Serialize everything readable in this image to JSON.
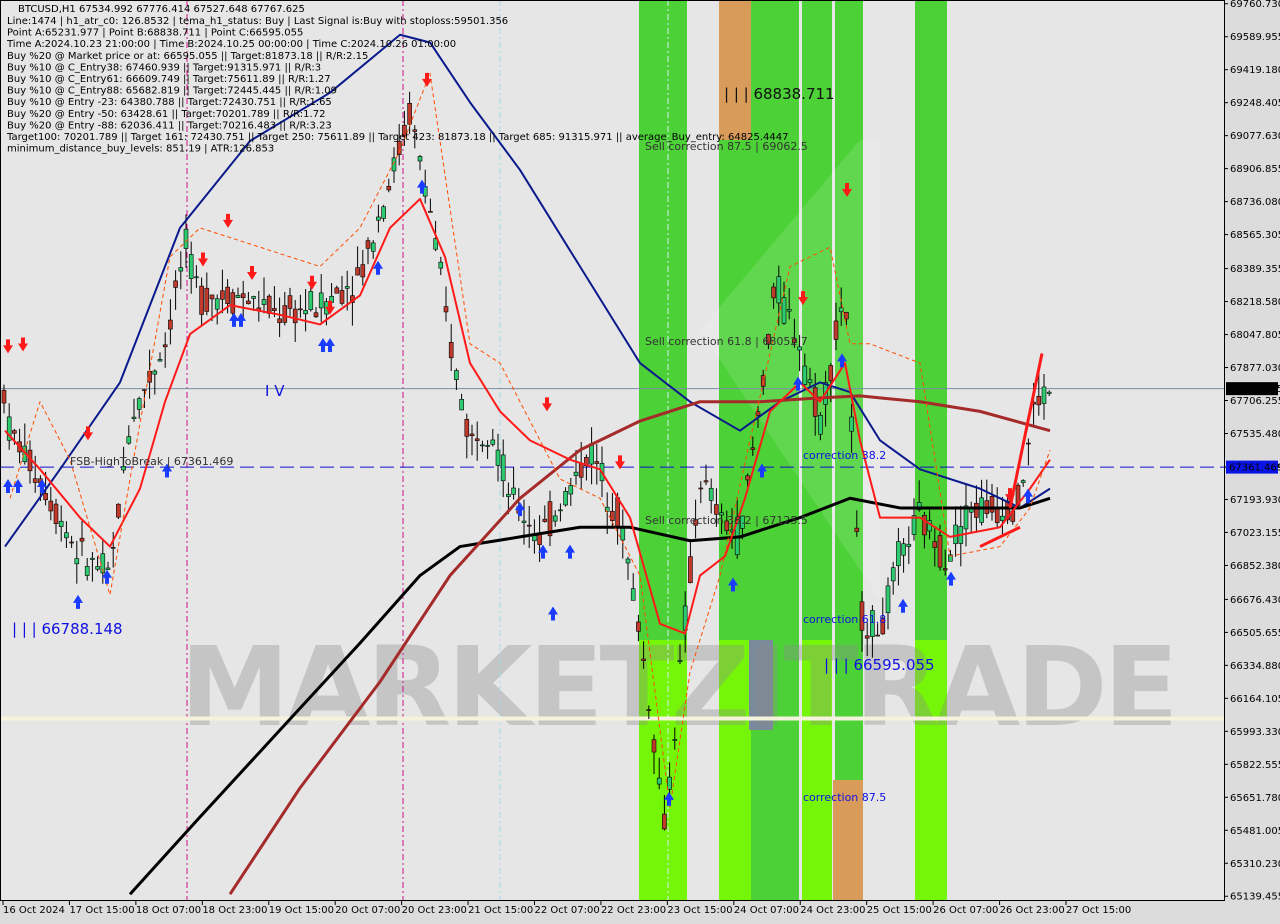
{
  "chart_data": {
    "type": "candlestick",
    "symbol": "BTCUSD",
    "timeframe": "H1",
    "title": "BTCUSD,H1  67534.992 67776.414 67527.648 67767.625",
    "ohlc_current": {
      "open": 67534.992,
      "high": 67776.414,
      "low": 67527.648,
      "close": 67767.625
    },
    "info_lines": [
      "Line:1474 | h1_atr_c0: 126.8532 | tema_h1_status: Buy | Last Signal is:Buy with stoploss:59501.356",
      "Point A:65231.977 | Point B:68838.711 | Point C:66595.055",
      "Time A:2024.10.23 21:00:00 | Time B:2024.10.25 00:00:00 | Time C:2024.10.26 01:00:00",
      "Buy %20 @ Market price or at: 66595.055 || Target:81873.18 || R/R:2.15",
      "Buy %10 @ C_Entry38: 67460.939 || Target:91315.971 || R/R:3",
      "Buy %10 @ C_Entry61: 66609.749 || Target:75611.89 || R/R:1.27",
      "Buy %10 @ C_Entry88: 65682.819 || Target:72445.445 || R/R:1.09",
      "Buy %10 @ Entry -23: 64380.788 || Target:72430.751 || R/R:1.65",
      "Buy %20 @ Entry -50: 63428.61 || Target:70201.789 || R/R:1.72",
      "Buy %20 @ Entry -88: 62036.411 || Target:70216.483 || R/R:3.23",
      "Target100: 70201.789 || Target 161: 72430.751 || Target 250: 75611.89 || Target 423: 81873.18 || Target 685: 91315.971 || average_Buy_entry: 64825.4447",
      "minimum_distance_buy_levels: 851.19 | ATR:126.853"
    ],
    "y_axis": {
      "ticks": [
        69760.73,
        69589.955,
        69419.18,
        69248.405,
        69077.63,
        68906.855,
        68736.08,
        68565.305,
        68389.355,
        68218.58,
        68047.805,
        67877.03,
        67706.255,
        67535.48,
        67361.469,
        67193.93,
        67023.155,
        66852.38,
        66676.43,
        66505.655,
        66334.88,
        66164.105,
        65993.33,
        65822.555,
        65651.78,
        65481.005,
        65310.23,
        65139.455
      ],
      "range": [
        65120,
        69780
      ]
    },
    "x_axis": {
      "ticks": [
        "16 Oct 2024",
        "17 Oct 15:00",
        "18 Oct 07:00",
        "18 Oct 23:00",
        "19 Oct 15:00",
        "20 Oct 07:00",
        "20 Oct 23:00",
        "21 Oct 15:00",
        "22 Oct 07:00",
        "22 Oct 23:00",
        "23 Oct 15:00",
        "24 Oct 07:00",
        "24 Oct 23:00",
        "25 Oct 15:00",
        "26 Oct 07:00",
        "26 Oct 23:00",
        "27 Oct 15:00"
      ]
    },
    "price_labels": [
      {
        "name": "current-price",
        "value": 67767.625,
        "text": "67767.625",
        "bg": "#000000",
        "fg": "#ffffff"
      },
      {
        "name": "fsb-level",
        "value": 67361.469,
        "text": "67361.469",
        "bg": "#0a14e6",
        "fg": "#ffffff"
      }
    ],
    "horizontal_lines": [
      {
        "name": "current-price-line",
        "value": 67767.625,
        "color": "#7b8ea6",
        "style": "solid"
      },
      {
        "name": "fsb-high-break-line",
        "value": 67361.469,
        "color": "#1010d0",
        "style": "dashed"
      },
      {
        "name": "support-band-line",
        "value": 66060,
        "color": "#f5f3dc",
        "style": "thick"
      }
    ],
    "annotations": [
      {
        "name": "point-b-label",
        "text": "| | | 68838.711",
        "color": "#111111",
        "big": true
      },
      {
        "name": "point-c-label",
        "text": "| | | 66595.055",
        "color": "#1010e0",
        "big": true
      },
      {
        "name": "low-label",
        "text": "| | | 66788.148",
        "color": "#1010e0",
        "big": true
      },
      {
        "name": "wave-iv-label",
        "text": "I V",
        "color": "#1010e0",
        "big": true
      },
      {
        "name": "fsb-label",
        "text": "FSB-HighToBreak | 67361.469",
        "color": "#333333",
        "big": false
      },
      {
        "name": "sell-correction-875",
        "text": "Sell correction 87.5 | 69062.5",
        "color": "#333333",
        "big": false
      },
      {
        "name": "sell-correction-618",
        "text": "Sell correction 61.8 | 68052.7",
        "color": "#333333",
        "big": false
      },
      {
        "name": "sell-correction-382",
        "text": "Sell correction 38.2 | 67125.5",
        "color": "#333333",
        "big": false
      },
      {
        "name": "correction-382",
        "text": "correction 38.2",
        "color": "#1010e0",
        "big": false
      },
      {
        "name": "correction-618",
        "text": "correction 61.8",
        "color": "#1010e0",
        "big": false
      },
      {
        "name": "correction-875",
        "text": "correction 87.5",
        "color": "#1010e0",
        "big": false
      }
    ],
    "watermark": "MARKETZITRADE",
    "series_colors": {
      "bull_candle": "#2ecc71",
      "bear_candle": "#c0392b",
      "ma_blue": "#0a1a8c",
      "ma_black": "#000000",
      "ma_darkred": "#a52a2a",
      "tema_red": "#ff1a1a",
      "envelope_orange": "#ff4d00",
      "zone_green": "#4cd137",
      "zone_lime": "#7cfc00",
      "zone_orange": "#d99b5a",
      "zone_gray": "#7a8a9a"
    }
  }
}
